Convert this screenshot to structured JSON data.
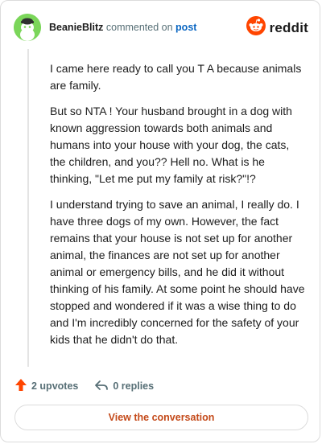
{
  "comment": {
    "username": "BeanieBlitz",
    "action_text": "commented on",
    "post_link": "post",
    "avatar_icon": "snoo-avatar-icon",
    "paragraphs": [
      "I came here ready to call you T A because animals are family.",
      "But so NTA ! Your husband brought in a dog with known aggression towards both animals and humans into your house with your dog, the cats, the children, and you?? Hell no. What is he thinking, \"Let me put my family at risk?\"!?",
      "I understand trying to save an animal, I really do. I have three dogs of my own. However, the fact remains that your house is not set up for another animal, the finances are not set up for another animal or emergency bills, and he did it without thinking of his family. At some point he should have stopped and wondered if it was a wise thing to do and I'm incredibly concerned for the safety of your kids that he didn't do that."
    ]
  },
  "brand": {
    "icon": "reddit-logo-icon",
    "name": "reddit",
    "color": "#ff4500"
  },
  "actions": {
    "upvotes": "2 upvotes",
    "replies": "0 replies",
    "upvote_icon": "upvote-arrow-icon",
    "reply_icon": "reply-arrow-icon",
    "upvote_color": "#ff4500"
  },
  "footer": {
    "view_button": "View the conversation",
    "accent": "#c44a1a"
  }
}
